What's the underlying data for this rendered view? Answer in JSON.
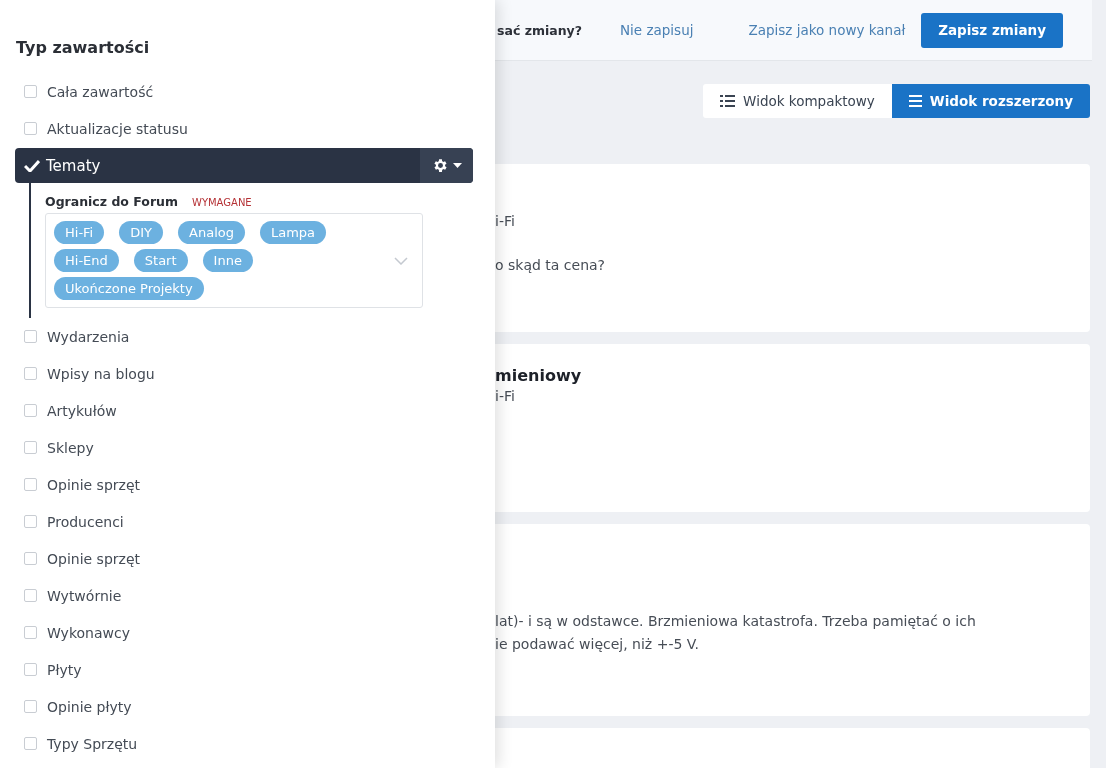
{
  "save_bar": {
    "question": "sać zmiany?",
    "discard_link": "Nie zapisuj",
    "save_new_link": "Zapisz jako nowy kanał",
    "save_button": "Zapisz zmiany"
  },
  "view_toggle": [
    {
      "label": "Widok kompaktowy",
      "selected": false
    },
    {
      "label": "Widok rozszerzony",
      "selected": true
    }
  ],
  "cards": [
    {
      "lines": [
        {
          "kind": "meta",
          "text": "i-Fi"
        },
        {
          "kind": "body",
          "text": "o skąd ta cena?"
        }
      ]
    },
    {
      "lines": [
        {
          "kind": "title",
          "text": "mieniowy"
        },
        {
          "kind": "meta",
          "text": "i-Fi"
        }
      ]
    },
    {
      "lines": [
        {
          "kind": "body",
          "text": "lat)- i są w odstawce. Brzmieniowa katastrofa. Trzeba pamiętać o ich"
        },
        {
          "kind": "body",
          "text": "ie podawać więcej, niż +-5 V."
        }
      ]
    }
  ],
  "panel": {
    "title": "Typ zawartości",
    "items": [
      {
        "label": "Cała zawartość",
        "checked": false
      },
      {
        "label": "Aktualizacje statusu",
        "checked": false
      },
      {
        "label": "Tematy",
        "checked": true,
        "filter": {
          "label": "Ogranicz do Forum",
          "badge": "WYMAGANE",
          "tags": [
            "Hi-Fi",
            "DIY",
            "Analog",
            "Lampa",
            "Hi-End",
            "Start",
            "Inne",
            "Ukończone Projekty"
          ]
        }
      },
      {
        "label": "Wydarzenia",
        "checked": false
      },
      {
        "label": "Wpisy na blogu",
        "checked": false
      },
      {
        "label": "Artykułów",
        "checked": false
      },
      {
        "label": "Sklepy",
        "checked": false
      },
      {
        "label": "Opinie sprzęt",
        "checked": false
      },
      {
        "label": "Producenci",
        "checked": false
      },
      {
        "label": "Opinie sprzęt",
        "checked": false
      },
      {
        "label": "Wytwórnie",
        "checked": false
      },
      {
        "label": "Wykonawcy",
        "checked": false
      },
      {
        "label": "Płyty",
        "checked": false
      },
      {
        "label": "Opinie płyty",
        "checked": false
      },
      {
        "label": "Typy Sprzętu",
        "checked": false
      }
    ]
  }
}
